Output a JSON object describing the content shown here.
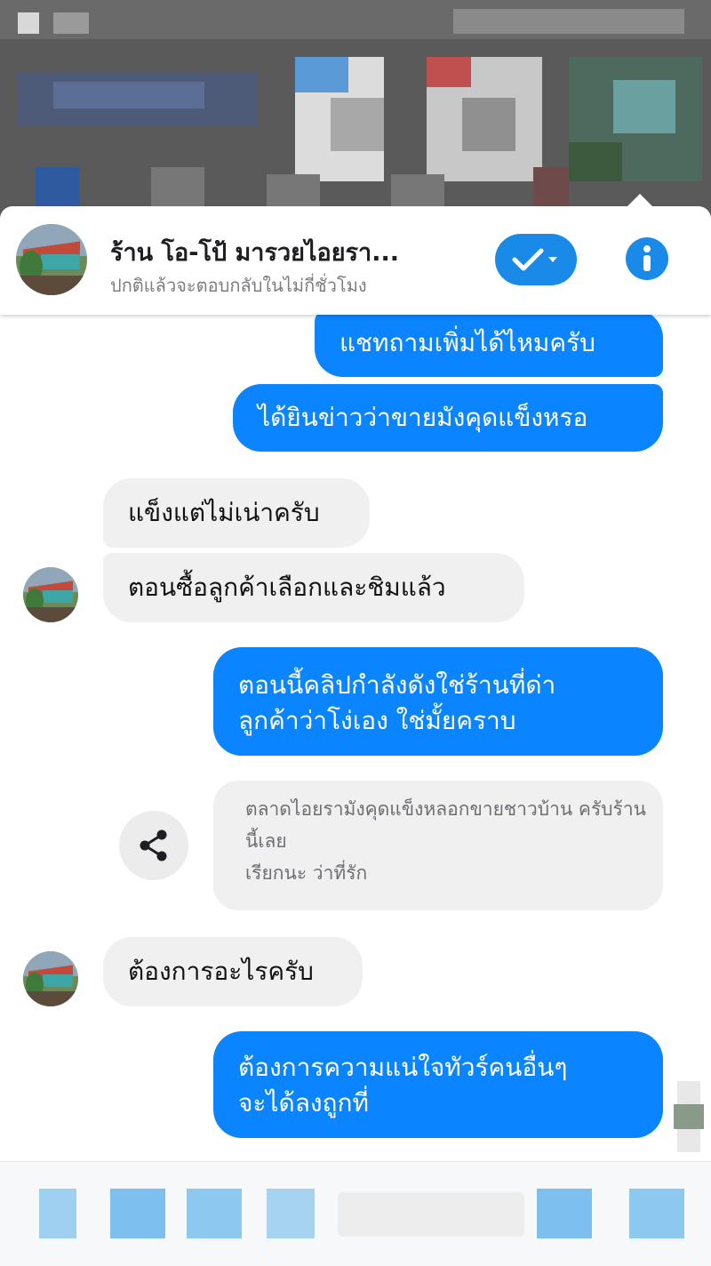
{
  "header": {
    "title": "ร้าน โอ-โป้ มารวยไอยรา...",
    "subtitle": "ปกติแล้วจะตอบกลับในไม่กี่ชั่วโมง",
    "check_icon": "check-dropdown-icon",
    "info_icon": "info-icon"
  },
  "messages": {
    "m1": "แชทถามเพิ่มได้ไหมครับ",
    "m2": "ได้ยินข่าวว่าขายมังคุดแข็งหรอ",
    "m3": "แข็งแต่ไม่เน่าครับ",
    "m4": "ตอนซื้อลูกค้าเลือกและชิมแล้ว",
    "m5_line1": "ตอนนี้คลิปกำลังดังใช่ร้านที่ด่า",
    "m5_line2": "ลูกค้าว่าโง่เอง ใช่มั้ยคราบ",
    "share_title": "ตลาดไอยรามังคุดแข็งหลอกขายชาวบ้าน ครับร้านนี้เลย",
    "share_author": "เรียกนะ ว่าที่รัก",
    "m6": "ต้องการอะไรครับ",
    "m7_line1": "ต้องการความแน่ใจทัวร์คนอื่นๆ",
    "m7_line2": "จะได้ลงถูกที่"
  },
  "colors": {
    "accent": "#0b84ff",
    "incoming_bubble": "#f0f0f0",
    "header_button": "#1a8ae8"
  }
}
